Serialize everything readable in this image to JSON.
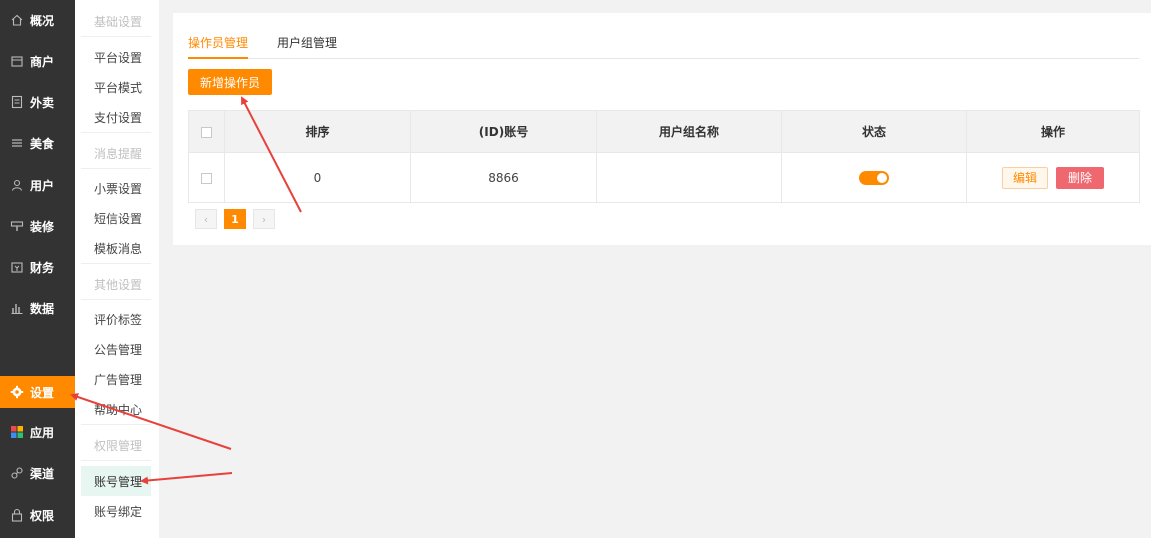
{
  "nav": {
    "items": [
      {
        "label": "概况",
        "icon": "home-icon"
      },
      {
        "label": "商户",
        "icon": "store-icon"
      },
      {
        "label": "外卖",
        "icon": "document-icon"
      },
      {
        "label": "美食",
        "icon": "menu-icon"
      },
      {
        "label": "用户",
        "icon": "user-icon"
      },
      {
        "label": "装修",
        "icon": "decorate-icon"
      },
      {
        "label": "财务",
        "icon": "wallet-icon"
      },
      {
        "label": "数据",
        "icon": "bar-chart-icon"
      },
      {
        "label": "设置",
        "icon": "gear-icon"
      },
      {
        "label": "应用",
        "icon": "apps-icon"
      },
      {
        "label": "渠道",
        "icon": "link-icon"
      },
      {
        "label": "权限",
        "icon": "lock-icon"
      }
    ],
    "active": "设置"
  },
  "sub_nav": {
    "groups": [
      {
        "title": "基础设置",
        "items": [
          "平台设置",
          "平台模式",
          "支付设置"
        ]
      },
      {
        "title": "消息提醒",
        "items": [
          "小票设置",
          "短信设置",
          "模板消息"
        ]
      },
      {
        "title": "其他设置",
        "items": [
          "评价标签",
          "公告管理",
          "广告管理",
          "帮助中心"
        ]
      },
      {
        "title": "权限管理",
        "items": [
          "账号管理",
          "账号绑定"
        ]
      }
    ],
    "active": "账号管理"
  },
  "main": {
    "tabs": [
      {
        "label": "操作员管理",
        "active": true
      },
      {
        "label": "用户组管理",
        "active": false
      }
    ],
    "add_button": "新增操作员",
    "table": {
      "headers": [
        "排序",
        "(ID)账号",
        "用户组名称",
        "状态",
        "操作"
      ],
      "rows": [
        {
          "sort": "0",
          "account": "8866",
          "group": "",
          "status": true,
          "edit": "编辑",
          "delete": "删除"
        }
      ]
    },
    "pagination": {
      "prev": "‹",
      "current": "1",
      "next": "›"
    }
  },
  "colors": {
    "accent": "#ff8a00",
    "nav_bg": "#333333",
    "danger": "#f0686f",
    "annotation_arrow": "#e8413c"
  }
}
